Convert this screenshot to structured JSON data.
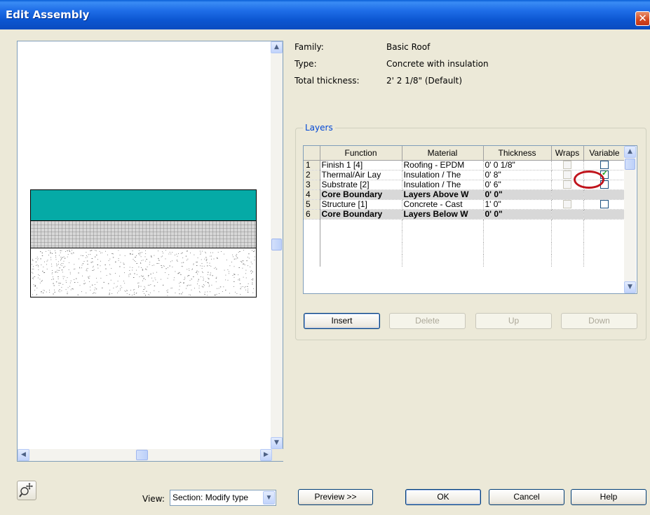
{
  "window": {
    "title": "Edit Assembly",
    "close_glyph": "✕"
  },
  "info": {
    "family_label": "Family:",
    "family_value": "Basic Roof",
    "type_label": "Type:",
    "type_value": "Concrete with insulation",
    "thickness_label": "Total thickness:",
    "thickness_value": "2'  2 1/8\" (Default)"
  },
  "layers": {
    "legend": "Layers",
    "headers": {
      "function": "Function",
      "material": "Material",
      "thickness": "Thickness",
      "wraps": "Wraps",
      "variable": "Variable"
    },
    "rows": [
      {
        "num": "1",
        "function": "Finish 1 [4]",
        "material": "Roofing - EPDM",
        "thickness": "0'  0 1/8\"",
        "wraps": false,
        "variable": false,
        "core": false
      },
      {
        "num": "2",
        "function": "Thermal/Air Lay",
        "material": "Insulation / The",
        "thickness": "0'  8\"",
        "wraps": false,
        "variable": true,
        "core": false
      },
      {
        "num": "3",
        "function": "Substrate [2]",
        "material": "Insulation / The",
        "thickness": "0'  6\"",
        "wraps": false,
        "variable": false,
        "core": false
      },
      {
        "num": "4",
        "function": "Core Boundary",
        "material": "Layers Above W",
        "thickness": "0'  0\"",
        "core": true
      },
      {
        "num": "5",
        "function": "Structure [1]",
        "material": "Concrete - Cast",
        "thickness": "1'  0\"",
        "wraps": false,
        "variable": false,
        "core": false
      },
      {
        "num": "6",
        "function": "Core Boundary",
        "material": "Layers Below W",
        "thickness": "0'  0\"",
        "core": true
      }
    ]
  },
  "buttons": {
    "insert": "Insert",
    "delete": "Delete",
    "up": "Up",
    "down": "Down",
    "preview": "Preview >>",
    "ok": "OK",
    "cancel": "Cancel",
    "help": "Help"
  },
  "view": {
    "label": "View:",
    "selected": "Section: Modify type"
  },
  "colors": {
    "finish_layer": "#05aaa6",
    "insulation_hatch": "#b8b8b8",
    "highlight": "#c0141c",
    "accent": "#0046d5"
  },
  "icons": [
    "close-icon",
    "scroll-up-icon",
    "scroll-down-icon",
    "scroll-left-icon",
    "scroll-right-icon",
    "zoom-icon",
    "checkbox-checked-icon",
    "dropdown-arrow-icon"
  ]
}
